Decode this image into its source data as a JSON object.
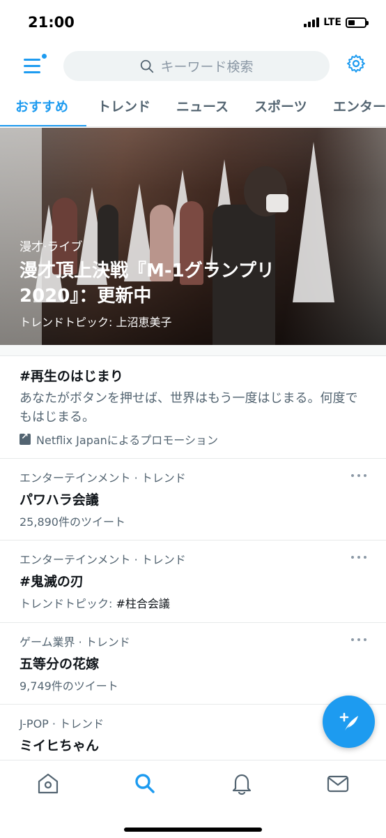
{
  "status_bar": {
    "time": "21:00",
    "network": "LTE"
  },
  "header": {
    "search_placeholder": "キーワード検索"
  },
  "tabs": [
    {
      "label": "おすすめ",
      "active": true
    },
    {
      "label": "トレンド",
      "active": false
    },
    {
      "label": "ニュース",
      "active": false
    },
    {
      "label": "スポーツ",
      "active": false
    },
    {
      "label": "エンター",
      "active": false
    }
  ],
  "hero": {
    "category": "漫才",
    "category_sep": "·",
    "category_type": "ライブ",
    "title": "漫才頂上決戦『M-1グランプリ2020』：更新中",
    "context": "トレンドトピック: 上沼恵美子"
  },
  "promoted": {
    "title": "#再生のはじまり",
    "description": "あなたがボタンを押せば、世界はもう一度はじまる。何度でもはじまる。",
    "promoted_by": "Netflix Japanによるプロモーション"
  },
  "trends": [
    {
      "meta": "エンターテインメント · トレンド",
      "name": "パワハラ会議",
      "sub_prefix": "25,890件のツイート",
      "sub_highlight": ""
    },
    {
      "meta": "エンターテインメント · トレンド",
      "name": "#鬼滅の刃",
      "sub_prefix": "トレンドトピック: ",
      "sub_highlight": "#柱合会議"
    },
    {
      "meta": "ゲーム業界 · トレンド",
      "name": "五等分の花嫁",
      "sub_prefix": "9,749件のツイート",
      "sub_highlight": ""
    },
    {
      "meta": "J-POP · トレンド",
      "name": "ミイヒちゃん",
      "sub_prefix": "",
      "sub_highlight": ""
    }
  ],
  "colors": {
    "accent": "#1d9bf0",
    "secondary_text": "#536471",
    "divider": "#e7e9ea"
  },
  "icons": {
    "menu": "menu-icon",
    "search": "search-icon",
    "settings": "gear-icon",
    "compose": "compose-tweet-icon",
    "home": "home-icon",
    "explore": "search-icon",
    "notifications": "bell-icon",
    "messages": "envelope-icon",
    "promoted": "promoted-icon",
    "more": "more-icon"
  }
}
